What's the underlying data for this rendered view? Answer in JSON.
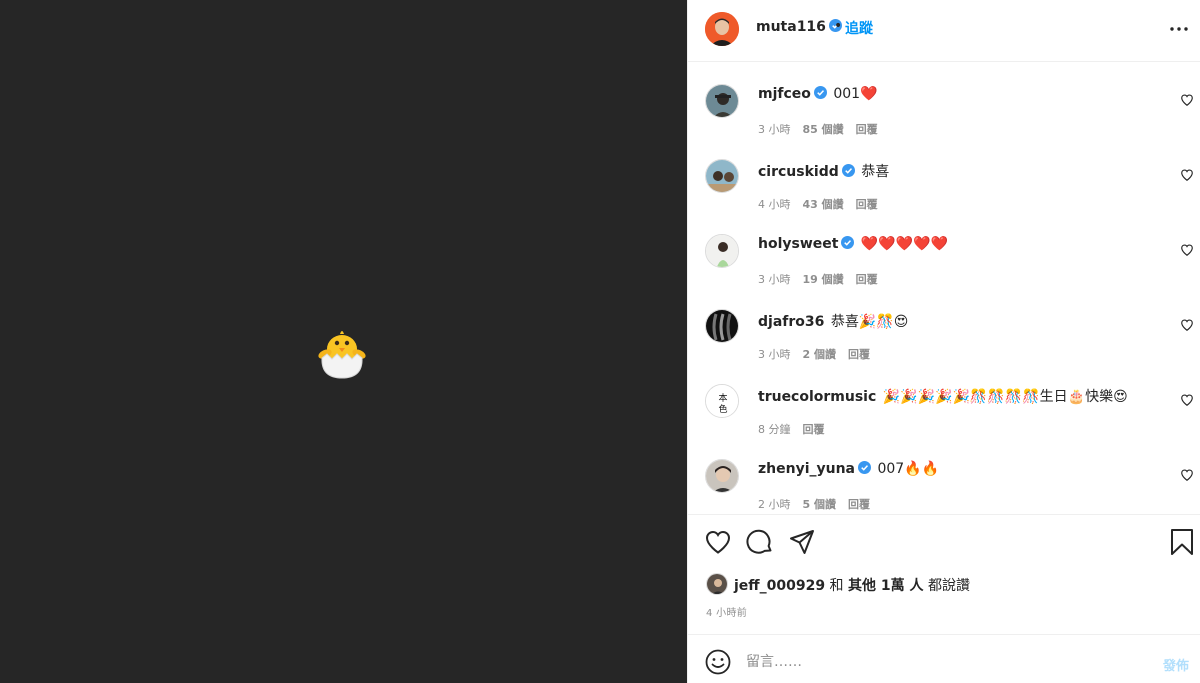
{
  "post": {
    "author": "muta116",
    "follow_label": "追蹤",
    "separator": "•"
  },
  "comments": [
    {
      "user": "mjfceo",
      "verified": true,
      "text": "001❤️",
      "time": "3 小時",
      "likes": "85 個讚",
      "reply": "回覆"
    },
    {
      "user": "circuskidd",
      "verified": true,
      "text": "恭喜",
      "time": "4 小時",
      "likes": "43 個讚",
      "reply": "回覆"
    },
    {
      "user": "holysweet",
      "verified": true,
      "text": "❤️❤️❤️❤️❤️",
      "time": "3 小時",
      "likes": "19 個讚",
      "reply": "回覆"
    },
    {
      "user": "djafro36",
      "verified": false,
      "text": "恭喜🎉🎊😍",
      "time": "3 小時",
      "likes": "2 個讚",
      "reply": "回覆"
    },
    {
      "user": "truecolormusic",
      "verified": false,
      "text": "🎉🎉🎉🎉🎉🎊🎊🎊🎊生日🎂快樂😍",
      "time": "8 分鐘",
      "likes": "",
      "reply": "回覆"
    },
    {
      "user": "zhenyi_yuna",
      "verified": true,
      "text": "007🔥🔥",
      "time": "2 小時",
      "likes": "5 個讚",
      "reply": "回覆"
    }
  ],
  "likes_summary": {
    "user": "jeff_000929",
    "connector": "和",
    "others": "其他 1萬 人",
    "suffix": "都說讚"
  },
  "posted_ago": "4 小時前",
  "comment_box": {
    "placeholder": "留言……",
    "post_label": "發佈"
  },
  "colors": {
    "accent": "#0095f6",
    "verified": "#3897f0",
    "media_bg": "#262626"
  }
}
